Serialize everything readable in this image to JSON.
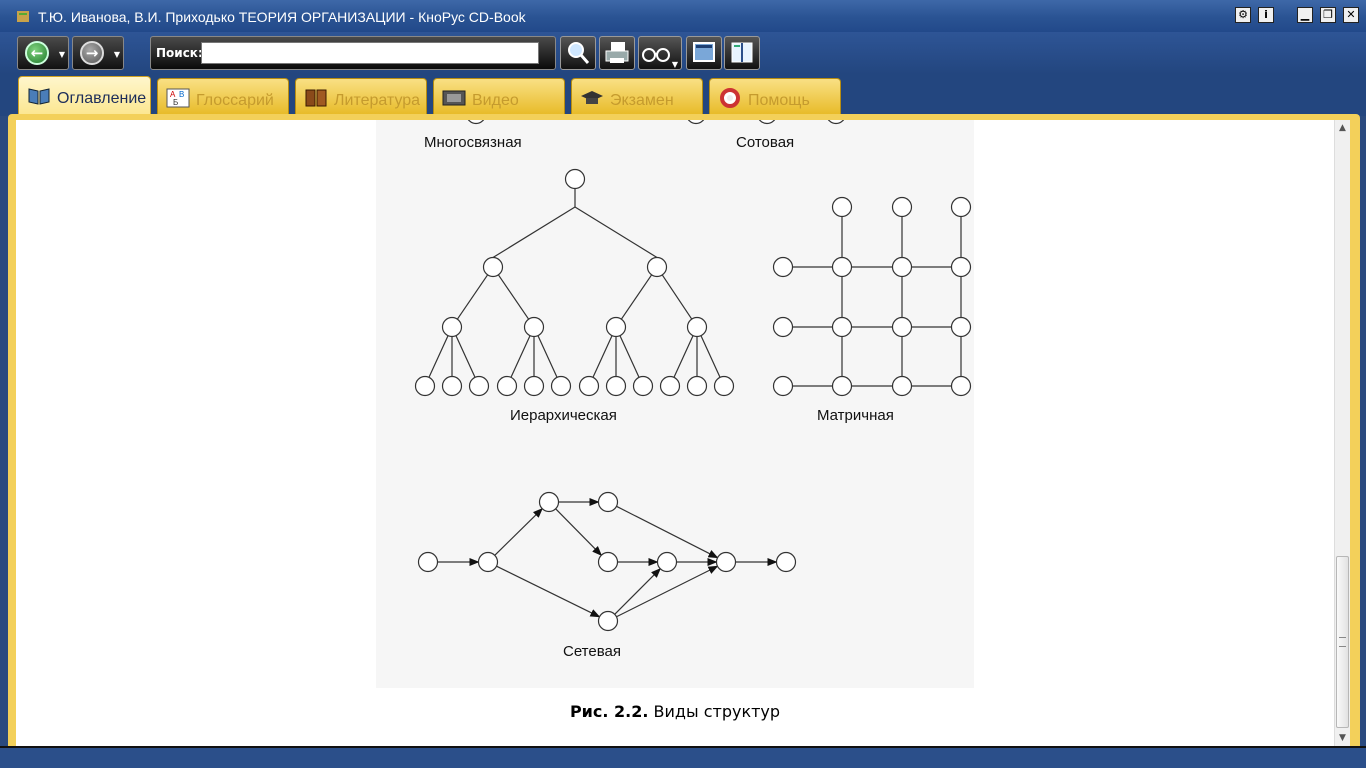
{
  "window": {
    "title": "Т.Ю. Иванова, В.И. Приходько ТЕОРИЯ ОРГАНИЗАЦИИ - КноРус CD-Book",
    "controls": {
      "settings": "⚙",
      "info": "i",
      "minimize": "▁",
      "restore": "❐",
      "close": "✕"
    }
  },
  "toolbar": {
    "back_icon": "←",
    "forward_icon": "→",
    "search_label": "Поиск:",
    "search_value": "",
    "search_placeholder": "",
    "buttons": [
      "find-icon",
      "print-icon",
      "glasses-icon",
      "window-icon",
      "book-icon"
    ]
  },
  "tabs": [
    {
      "label": "Оглавление",
      "icon": "book-icon",
      "active": true
    },
    {
      "label": "Глоссарий",
      "icon": "glossary-icon",
      "active": false
    },
    {
      "label": "Литература",
      "icon": "books-icon",
      "active": false
    },
    {
      "label": "Видео",
      "icon": "film-icon",
      "active": false
    },
    {
      "label": "Экзамен",
      "icon": "graduation-cap-icon",
      "active": false
    },
    {
      "label": "Помощь",
      "icon": "lifebuoy-icon",
      "active": false
    }
  ],
  "figure": {
    "labels": {
      "multi": "Многосвязная",
      "cell": "Сотовая",
      "hier": "Иерархическая",
      "matrix": "Матричная",
      "network": "Сетевая"
    },
    "caption_bold": "Рис. 2.2.",
    "caption_text": " Виды структур"
  },
  "colors": {
    "accent": "#f3d05a",
    "titlebar": "#2a5393"
  }
}
